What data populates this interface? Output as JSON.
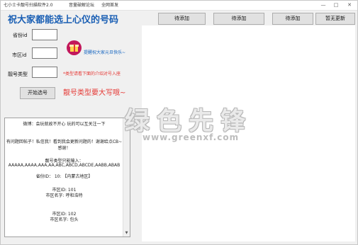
{
  "titlebar": {
    "app_title": "七小士卡靓号扫描软件2.0",
    "menu": [
      "音量破解论坛",
      "全网首发"
    ],
    "minimize": "—",
    "maximize": "□",
    "close": "✕"
  },
  "heading": "祝大家都能选上心仪的号码",
  "top_buttons": [
    "待添加",
    "待添加",
    "待添加",
    "暂无更新"
  ],
  "form": {
    "province_label": "省份id",
    "city_label": "市区id",
    "type_label": "靓号类型",
    "province_value": "",
    "city_value": "",
    "type_value": "",
    "start_button": "开始选号"
  },
  "promo_link": "提醒祝大家元旦快乐~",
  "hint_red": "*类型请看下面的介绍对号入座",
  "hint_big": "靓号类型要大写哦~",
  "info_panel": {
    "l1": "微博：会玩就故不开心    玩的可以互关注一下",
    "l2": "有问题回帖子！私信我！看到我会更新问题的！谢谢给点CB~",
    "l3": "感谢！",
    "l4": "靓号类型只能输入：",
    "l5": "AAAAA,AAAA,AAA,AA,ABC,ABCD,ABCDE,AABB,ABAB",
    "l6": "省份ID：  10:  【内蒙古地区】",
    "l7": "市区ID: 101",
    "l8": "市区名字: 呼和浩特",
    "l9": "市区ID: 102",
    "l10": "市区名字: 包头"
  },
  "watermark": {
    "text": "绿色先锋",
    "url": "www.greenxf.com"
  }
}
